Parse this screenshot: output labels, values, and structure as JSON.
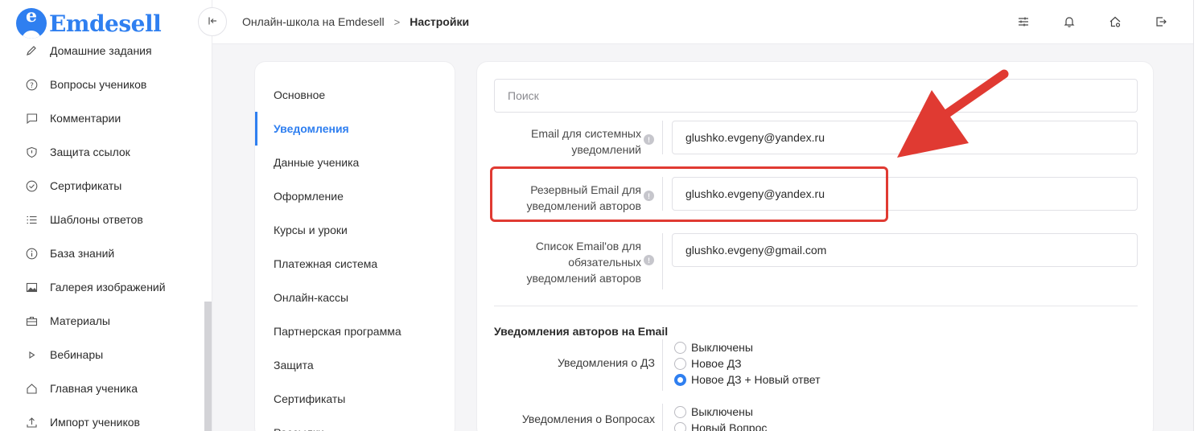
{
  "app": {
    "logo_text": "Emdesell",
    "logo_letter": "e"
  },
  "sidebar": {
    "items": [
      {
        "label": "Домашние задания",
        "icon": "pencil-icon"
      },
      {
        "label": "Вопросы учеников",
        "icon": "question-circle-icon"
      },
      {
        "label": "Комментарии",
        "icon": "comment-icon"
      },
      {
        "label": "Защита ссылок",
        "icon": "shield-icon"
      },
      {
        "label": "Сертификаты",
        "icon": "check-circle-icon"
      },
      {
        "label": "Шаблоны ответов",
        "icon": "list-icon"
      },
      {
        "label": "База знаний",
        "icon": "info-circle-icon"
      },
      {
        "label": "Галерея изображений",
        "icon": "image-icon"
      },
      {
        "label": "Материалы",
        "icon": "briefcase-icon"
      },
      {
        "label": "Вебинары",
        "icon": "play-icon"
      },
      {
        "label": "Главная ученика",
        "icon": "home-icon"
      },
      {
        "label": "Импорт учеников",
        "icon": "upload-icon"
      }
    ]
  },
  "topbar": {
    "collapse_icon": "collapse-left-icon",
    "breadcrumb": {
      "parent": "Онлайн-школа на Emdesell",
      "separator": ">",
      "current": "Настройки"
    },
    "icons": [
      "sliders-icon",
      "bell-icon",
      "home-settings-icon",
      "logout-icon"
    ]
  },
  "settings_nav": {
    "items": [
      {
        "label": "Основное",
        "active": false
      },
      {
        "label": "Уведомления",
        "active": true
      },
      {
        "label": "Данные ученика",
        "active": false
      },
      {
        "label": "Оформление",
        "active": false
      },
      {
        "label": "Курсы и уроки",
        "active": false
      },
      {
        "label": "Платежная система",
        "active": false
      },
      {
        "label": "Онлайн-кассы",
        "active": false
      },
      {
        "label": "Партнерская программа",
        "active": false
      },
      {
        "label": "Защита",
        "active": false
      },
      {
        "label": "Сертификаты",
        "active": false
      },
      {
        "label": "Рассылки",
        "active": false
      }
    ]
  },
  "main": {
    "search": {
      "placeholder": "Поиск",
      "value": ""
    },
    "fields": [
      {
        "label_line1": "Email для системных",
        "label_line2": "уведомлений",
        "value": "glushko.evgeny@yandex.ru"
      },
      {
        "label_line1": "Резервный Email для",
        "label_line2": "уведомлений авторов",
        "value": "glushko.evgeny@yandex.ru"
      },
      {
        "label_line1": "Список Email'ов для",
        "label_line2": "обязательных",
        "label_line3": "уведомлений авторов",
        "value": "glushko.evgeny@gmail.com"
      }
    ],
    "info_mark": "!",
    "section_title": "Уведомления авторов на Email",
    "radio_groups": [
      {
        "label": "Уведомления о ДЗ",
        "options": [
          "Выключены",
          "Новое ДЗ",
          "Новое ДЗ + Новый ответ"
        ],
        "selected_index": 2
      },
      {
        "label": "Уведомления о Вопросах",
        "options": [
          "Выключены",
          "Новый Вопрос"
        ],
        "selected_index": -1
      }
    ]
  },
  "colors": {
    "accent": "#2f7ff0",
    "annotation": "#e03a32",
    "background": "#f5f5f7"
  }
}
